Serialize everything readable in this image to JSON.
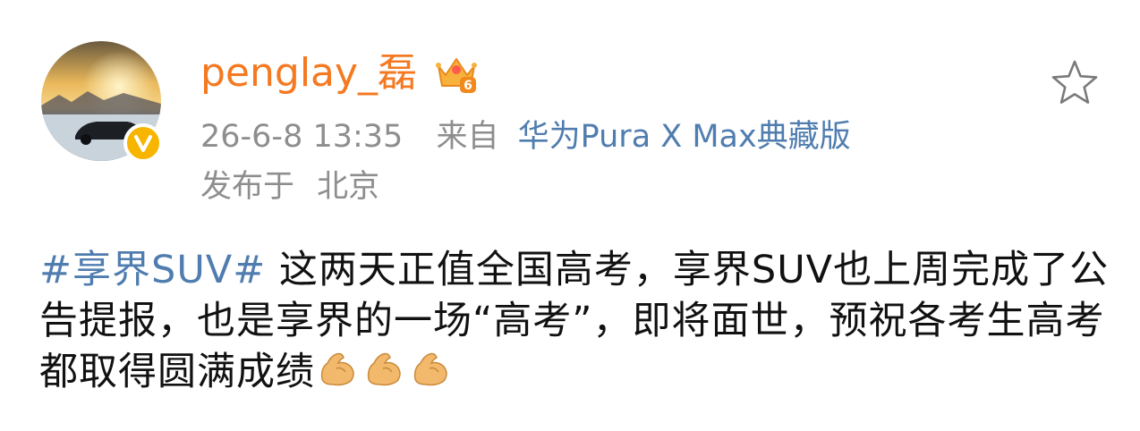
{
  "user": {
    "name": "penglay_磊",
    "avatar": "avatar-photo-car-sunset",
    "verified_badge": "V",
    "vip_level": "6"
  },
  "meta": {
    "time": "26-6-8 13:35",
    "from_label": "来自",
    "device": "华为Pura X Max典藏版",
    "location_prefix": "发布于",
    "location": "北京"
  },
  "post": {
    "hashtag": "#享界SUV#",
    "text": " 这两天正值全国高考，享界SUV也上周完成了公告提报，也是享界的一场“高考”，即将面世，预祝各考生高考都取得圆满成绩",
    "emoji": "flexed-biceps x3"
  },
  "colors": {
    "username": "#f47920",
    "link": "#507daf",
    "meta_text": "#8e8e8e",
    "body_text": "#111111",
    "badge": "#f7b500"
  },
  "icons": {
    "favorite": "star-outline-icon",
    "crown": "crown-icon",
    "verified": "verified-v-icon",
    "emoji": "flexed-biceps-icon"
  }
}
